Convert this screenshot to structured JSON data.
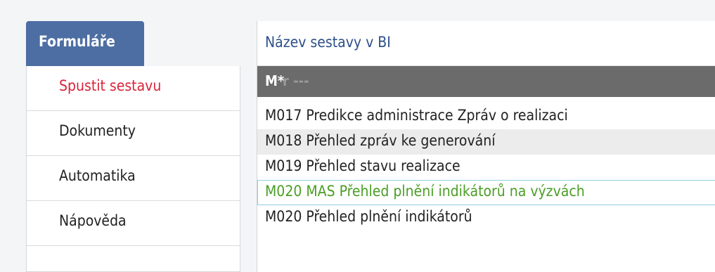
{
  "panel": {
    "title": "Formuláře",
    "items": [
      {
        "label": "Spustit sestavu",
        "active": true
      },
      {
        "label": "Dokumenty",
        "active": false
      },
      {
        "label": "Automatika",
        "active": false
      },
      {
        "label": "Nápověda",
        "active": false
      }
    ]
  },
  "list": {
    "header": "Název sestavy v BI",
    "selected_value": "M*",
    "selected_placeholder": "r ---",
    "rows": [
      {
        "label": "M017 Predikce administrace Zpráv o realizaci"
      },
      {
        "label": "M018 Přehled zpráv ke generování"
      },
      {
        "label": "M019 Přehled stavu realizace"
      },
      {
        "label": "M020 MAS Přehled plnění indikátorů na výzvách"
      },
      {
        "label": "M020 Přehled plnění indikátorů"
      }
    ]
  },
  "colors": {
    "panel_header_bg": "#4d6ea3",
    "active_item_text": "#d9243a",
    "list_header_text": "#2e4f8a",
    "highlight_text": "#4a9e25",
    "highlight_border": "#8fd0e2",
    "selected_bar_bg": "#6b6b6b"
  }
}
